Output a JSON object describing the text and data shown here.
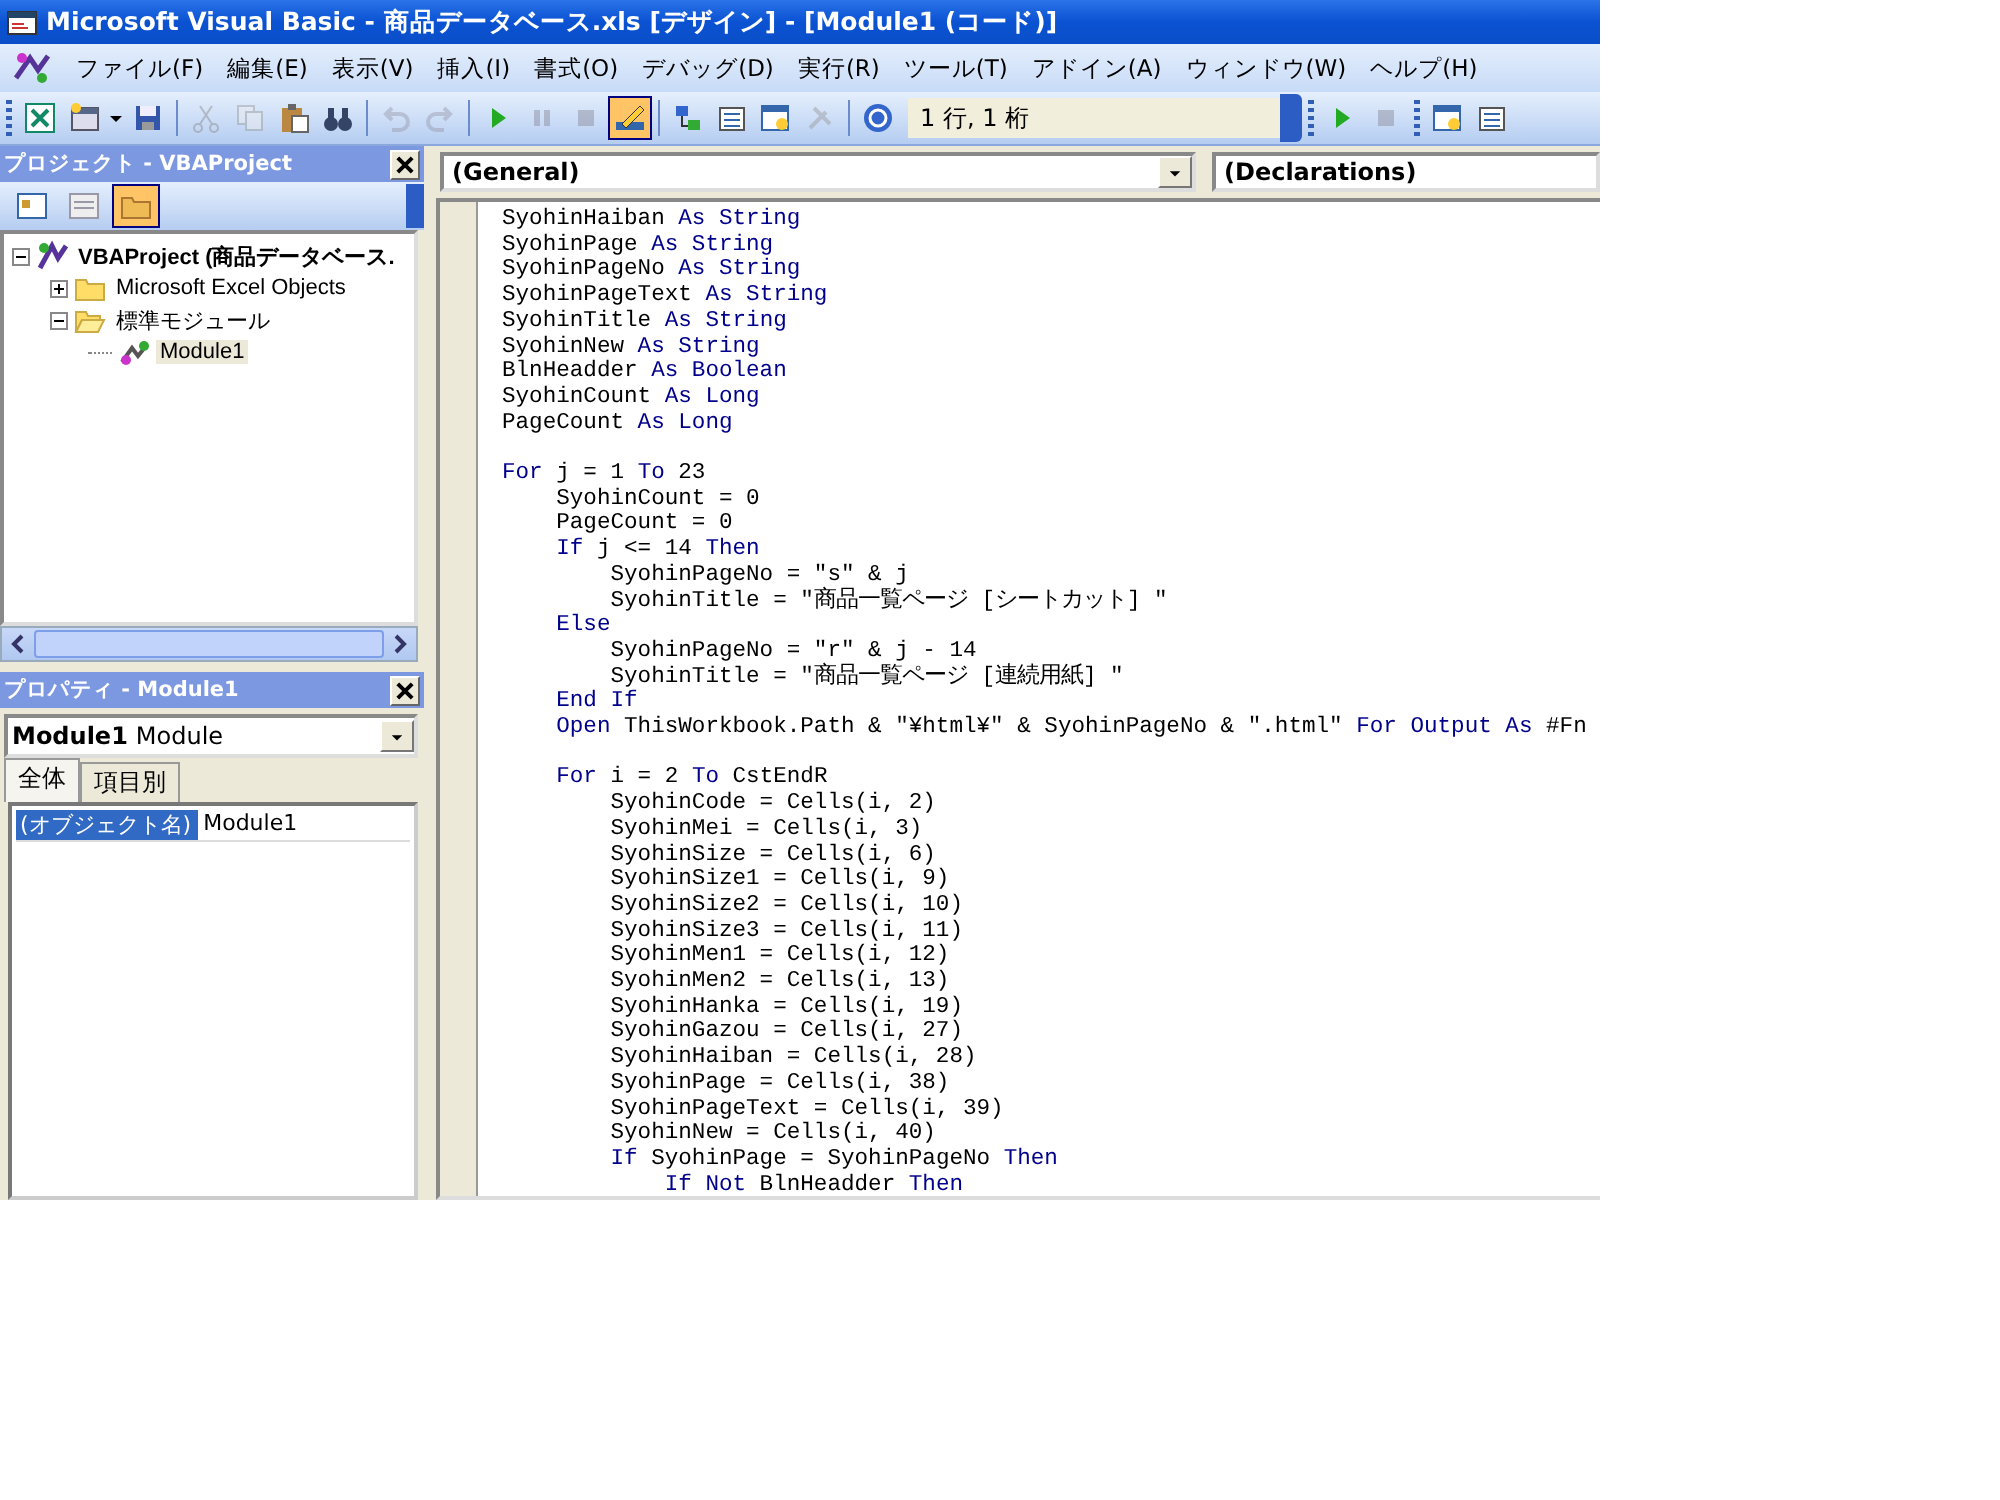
{
  "window": {
    "title": "Microsoft Visual Basic - 商品データベース.xls [デザイン] - [Module1 (コード)]"
  },
  "menu": [
    "ファイル(F)",
    "編集(E)",
    "表示(V)",
    "挿入(I)",
    "書式(O)",
    "デバッグ(D)",
    "実行(R)",
    "ツール(T)",
    "アドイン(A)",
    "ウィンドウ(W)",
    "ヘルプ(H)"
  ],
  "toolbar": [
    {
      "kind": "excel",
      "disabled": false
    },
    {
      "kind": "userform",
      "disabled": false
    },
    {
      "kind": "caret",
      "disabled": false
    },
    {
      "kind": "save",
      "disabled": false
    },
    {
      "kind": "separator"
    },
    {
      "kind": "cut",
      "disabled": true
    },
    {
      "kind": "copy",
      "disabled": true
    },
    {
      "kind": "paste",
      "disabled": false
    },
    {
      "kind": "find",
      "disabled": false
    },
    {
      "kind": "separator"
    },
    {
      "kind": "undo",
      "disabled": true
    },
    {
      "kind": "redo",
      "disabled": true
    },
    {
      "kind": "separator"
    },
    {
      "kind": "run",
      "disabled": false
    },
    {
      "kind": "pause",
      "disabled": true
    },
    {
      "kind": "stop",
      "disabled": true
    },
    {
      "kind": "design",
      "disabled": false,
      "pressed": true
    },
    {
      "kind": "separator"
    },
    {
      "kind": "explorer",
      "disabled": false
    },
    {
      "kind": "properties",
      "disabled": false
    },
    {
      "kind": "browser",
      "disabled": false
    },
    {
      "kind": "toolbox",
      "disabled": true
    },
    {
      "kind": "separator"
    },
    {
      "kind": "help",
      "disabled": false
    }
  ],
  "position": "1 行, 1 桁",
  "toolbar_right": [
    {
      "kind": "run",
      "disabled": false
    },
    {
      "kind": "stop",
      "disabled": true
    },
    {
      "kind": "grip"
    },
    {
      "kind": "browser",
      "disabled": false
    },
    {
      "kind": "properties",
      "disabled": false
    }
  ],
  "project_pane": {
    "title": "プロジェクト - VBAProject",
    "buttons": [
      {
        "kind": "code",
        "selected": false
      },
      {
        "kind": "object",
        "selected": false
      },
      {
        "kind": "folders",
        "selected": true
      }
    ],
    "tree": [
      {
        "label": "VBAProject (商品データベース.",
        "kind": "project",
        "expanded": true,
        "selected": false,
        "children": [
          {
            "label": "Microsoft Excel Objects",
            "kind": "folder",
            "expanded": false,
            "selected": false
          },
          {
            "label": "標準モジュール",
            "kind": "openfolder",
            "expanded": true,
            "selected": false,
            "children": [
              {
                "label": "Module1",
                "kind": "module",
                "selected": true
              }
            ]
          }
        ]
      }
    ]
  },
  "properties_pane": {
    "title": "プロパティ - Module1",
    "object": {
      "name": "Module1",
      "type": "Module"
    },
    "tabs": [
      {
        "label": "全体",
        "selected": true
      },
      {
        "label": "項目別",
        "selected": false
      }
    ],
    "rows": [
      {
        "name": "(オブジェクト名)",
        "value": "Module1",
        "selected": true
      }
    ]
  },
  "code_window": {
    "object": "(General)",
    "procedure": "(Declarations)",
    "lines": [
      {
        "segments": [
          {
            "text": "SyohinHaiban ",
            "kind": "plain"
          },
          {
            "text": "As String",
            "kind": "keyword"
          }
        ]
      },
      {
        "segments": [
          {
            "text": "SyohinPage ",
            "kind": "plain"
          },
          {
            "text": "As String",
            "kind": "keyword"
          }
        ]
      },
      {
        "segments": [
          {
            "text": "SyohinPageNo ",
            "kind": "plain"
          },
          {
            "text": "As String",
            "kind": "keyword"
          }
        ]
      },
      {
        "segments": [
          {
            "text": "SyohinPageText ",
            "kind": "plain"
          },
          {
            "text": "As String",
            "kind": "keyword"
          }
        ]
      },
      {
        "segments": [
          {
            "text": "SyohinTitle ",
            "kind": "plain"
          },
          {
            "text": "As String",
            "kind": "keyword"
          }
        ]
      },
      {
        "segments": [
          {
            "text": "SyohinNew ",
            "kind": "plain"
          },
          {
            "text": "As String",
            "kind": "keyword"
          }
        ]
      },
      {
        "segments": [
          {
            "text": "BlnHeadder ",
            "kind": "plain"
          },
          {
            "text": "As Boolean",
            "kind": "keyword"
          }
        ]
      },
      {
        "segments": [
          {
            "text": "SyohinCount ",
            "kind": "plain"
          },
          {
            "text": "As Long",
            "kind": "keyword"
          }
        ]
      },
      {
        "segments": [
          {
            "text": "PageCount ",
            "kind": "plain"
          },
          {
            "text": "As Long",
            "kind": "keyword"
          }
        ]
      },
      {
        "gap_before": true,
        "segments": [
          {
            "text": "For",
            "kind": "keyword"
          },
          {
            "text": " j = 1 ",
            "kind": "plain"
          },
          {
            "text": "To",
            "kind": "keyword"
          },
          {
            "text": " 23",
            "kind": "plain"
          }
        ]
      },
      {
        "segments": [
          {
            "text": "    SyohinCount = 0",
            "kind": "plain"
          }
        ]
      },
      {
        "segments": [
          {
            "text": "    PageCount = 0",
            "kind": "plain"
          }
        ]
      },
      {
        "segments": [
          {
            "text": "    If",
            "kind": "keyword"
          },
          {
            "text": " j <= 14 ",
            "kind": "plain"
          },
          {
            "text": "Then",
            "kind": "keyword"
          }
        ]
      },
      {
        "segments": [
          {
            "text": "        SyohinPageNo = \"s\" & j",
            "kind": "plain"
          }
        ]
      },
      {
        "segments": [
          {
            "text": "        SyohinTitle = \"商品一覧ページ [シートカット] \"",
            "kind": "plain"
          }
        ]
      },
      {
        "segments": [
          {
            "text": "    Else",
            "kind": "keyword"
          }
        ]
      },
      {
        "segments": [
          {
            "text": "        SyohinPageNo = \"r\" & j - 14",
            "kind": "plain"
          }
        ]
      },
      {
        "segments": [
          {
            "text": "        SyohinTitle = \"商品一覧ページ [連続用紙] \"",
            "kind": "plain"
          }
        ]
      },
      {
        "segments": [
          {
            "text": "    End If",
            "kind": "keyword"
          }
        ]
      },
      {
        "segments": [
          {
            "text": "    Open",
            "kind": "keyword"
          },
          {
            "text": " ThisWorkbook.Path & \"¥html¥\" & SyohinPageNo & \".html\" ",
            "kind": "plain"
          },
          {
            "text": "For Output As",
            "kind": "keyword"
          },
          {
            "text": " #Fn",
            "kind": "plain"
          }
        ]
      },
      {
        "gap_before": true,
        "segments": [
          {
            "text": "    For",
            "kind": "keyword"
          },
          {
            "text": " i = 2 ",
            "kind": "plain"
          },
          {
            "text": "To",
            "kind": "keyword"
          },
          {
            "text": " CstEndR",
            "kind": "plain"
          }
        ]
      },
      {
        "segments": [
          {
            "text": "        SyohinCode = Cells(i, 2)",
            "kind": "plain"
          }
        ]
      },
      {
        "segments": [
          {
            "text": "        SyohinMei = Cells(i, 3)",
            "kind": "plain"
          }
        ]
      },
      {
        "segments": [
          {
            "text": "        SyohinSize = Cells(i, 6)",
            "kind": "plain"
          }
        ]
      },
      {
        "segments": [
          {
            "text": "        SyohinSize1 = Cells(i, 9)",
            "kind": "plain"
          }
        ]
      },
      {
        "segments": [
          {
            "text": "        SyohinSize2 = Cells(i, 10)",
            "kind": "plain"
          }
        ]
      },
      {
        "segments": [
          {
            "text": "        SyohinSize3 = Cells(i, 11)",
            "kind": "plain"
          }
        ]
      },
      {
        "segments": [
          {
            "text": "        SyohinMen1 = Cells(i, 12)",
            "kind": "plain"
          }
        ]
      },
      {
        "segments": [
          {
            "text": "        SyohinMen2 = Cells(i, 13)",
            "kind": "plain"
          }
        ]
      },
      {
        "segments": [
          {
            "text": "        SyohinHanka = Cells(i, 19)",
            "kind": "plain"
          }
        ]
      },
      {
        "segments": [
          {
            "text": "        SyohinGazou = Cells(i, 27)",
            "kind": "plain"
          }
        ]
      },
      {
        "segments": [
          {
            "text": "        SyohinHaiban = Cells(i, 28)",
            "kind": "plain"
          }
        ]
      },
      {
        "segments": [
          {
            "text": "        SyohinPage = Cells(i, 38)",
            "kind": "plain"
          }
        ]
      },
      {
        "segments": [
          {
            "text": "        SyohinPageText = Cells(i, 39)",
            "kind": "plain"
          }
        ]
      },
      {
        "segments": [
          {
            "text": "        SyohinNew = Cells(i, 40)",
            "kind": "plain"
          }
        ]
      },
      {
        "segments": [
          {
            "text": "        If",
            "kind": "keyword"
          },
          {
            "text": " SyohinPage = SyohinPageNo ",
            "kind": "plain"
          },
          {
            "text": "Then",
            "kind": "keyword"
          }
        ]
      },
      {
        "segments": [
          {
            "text": "            If Not",
            "kind": "keyword"
          },
          {
            "text": " BlnHeadder ",
            "kind": "plain"
          },
          {
            "text": "Then",
            "kind": "keyword"
          }
        ]
      }
    ]
  }
}
